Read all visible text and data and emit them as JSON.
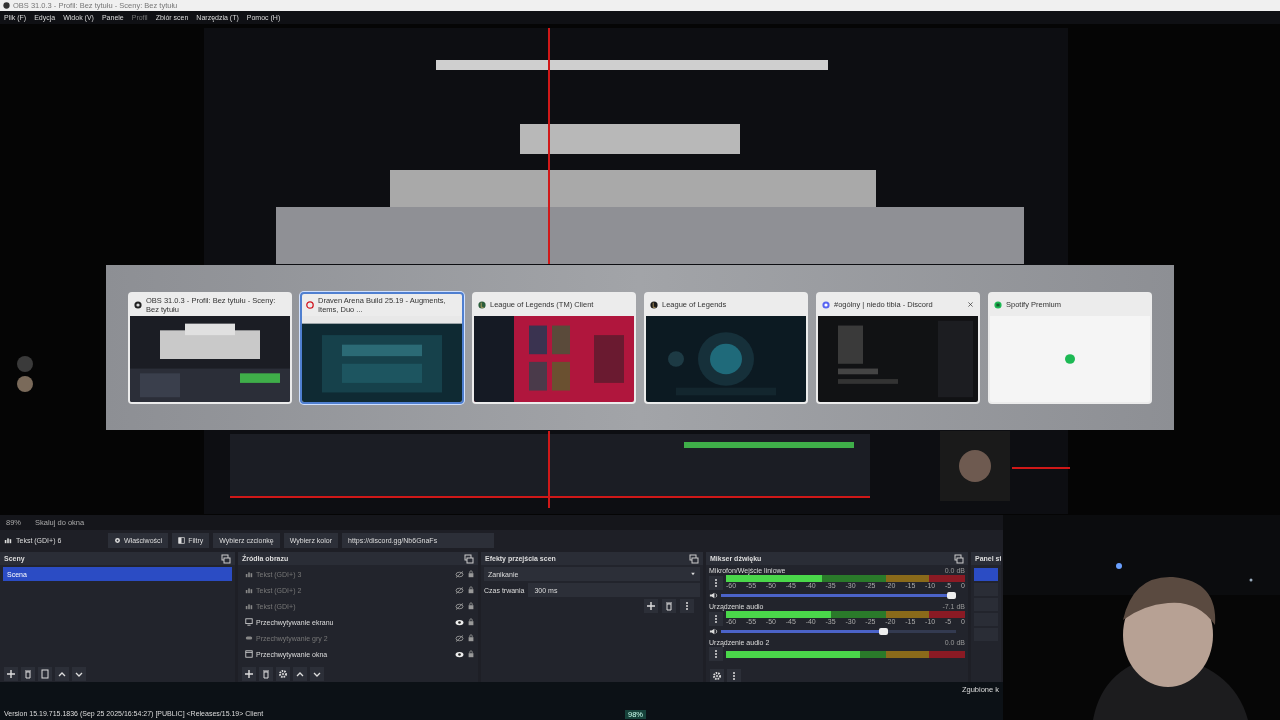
{
  "window": {
    "title": "OBS 31.0.3 - Profil: Bez tytułu - Sceny: Bez tytułu"
  },
  "menu": [
    {
      "label": "Plik (F)",
      "disabled": false
    },
    {
      "label": "Edycja",
      "disabled": false
    },
    {
      "label": "Widok (V)",
      "disabled": false
    },
    {
      "label": "Panele",
      "disabled": false
    },
    {
      "label": "Profil",
      "disabled": true
    },
    {
      "label": "Zbiór scen",
      "disabled": false
    },
    {
      "label": "Narzędzia (T)",
      "disabled": false
    },
    {
      "label": "Pomoc (H)",
      "disabled": false
    }
  ],
  "preview": {
    "kind": "picture",
    "task_switcher": [
      {
        "title": "OBS 31.0.3 - Profil: Bez tytułu - Sceny: Bez tytułu",
        "selected": false,
        "closable": false
      },
      {
        "title": "Draven Arena Build 25.19 - Augments, Items, Duo ...",
        "selected": true,
        "closable": false
      },
      {
        "title": "League of Legends (TM) Client",
        "selected": false,
        "closable": false
      },
      {
        "title": "League of Legends",
        "selected": false,
        "closable": false
      },
      {
        "title": "#ogólny | niedo tibia - Discord",
        "selected": false,
        "closable": true
      },
      {
        "title": "Spotify Premium",
        "selected": false,
        "closable": false
      }
    ]
  },
  "zoom_bar": {
    "zoom": "89%",
    "mode": "Skaluj do okna"
  },
  "source_toolbar": {
    "source": "Tekst (GDI+) 6",
    "buttons": [
      "Właściwości",
      "Filtry",
      "Wybierz czcionkę",
      "Wybierz kolor"
    ],
    "text_value": "https://discord.gg/Nb6GnaFs"
  },
  "scenes": {
    "title": "Sceny",
    "items": [
      {
        "label": "Scena",
        "selected": true
      }
    ]
  },
  "sources": {
    "title": "Źródła obrazu",
    "items": [
      {
        "label": "Tekst (GDI+) 3",
        "kind": "text",
        "visible": false
      },
      {
        "label": "Tekst (GDI+) 2",
        "kind": "text",
        "visible": false
      },
      {
        "label": "Tekst (GDI+)",
        "kind": "text",
        "visible": false
      },
      {
        "label": "Przechwytywanie ekranu",
        "kind": "display",
        "visible": true
      },
      {
        "label": "Przechwytywanie gry 2",
        "kind": "game",
        "visible": false
      },
      {
        "label": "Przechwytywanie okna",
        "kind": "window",
        "visible": true
      }
    ]
  },
  "transitions": {
    "title": "Efekty przejścia scen",
    "effect": "Zanikanie",
    "duration_label": "Czas trwania",
    "duration": "300 ms"
  },
  "mixer": {
    "title": "Mikser dźwięku",
    "channels": [
      {
        "name": "Mikrofon/Wejście liniowe",
        "reading": "0.0 dB",
        "level": 0.4,
        "ticks": [
          "-60",
          "-55",
          "-50",
          "-45",
          "-40",
          "-35",
          "-30",
          "-25",
          "-20",
          "-15",
          "-10",
          "-5",
          "0"
        ],
        "volume": {
          "level": 1.0
        }
      },
      {
        "name": "Urządzenie audio",
        "reading": "-7.1 dB",
        "level": 0.44,
        "ticks": [
          "-60",
          "-55",
          "-50",
          "-45",
          "-40",
          "-35",
          "-30",
          "-25",
          "-20",
          "-15",
          "-10",
          "-5",
          "0"
        ],
        "volume": {
          "level": 0.7
        }
      },
      {
        "name": "Urządzenie audio 2",
        "reading": "0.0 dB",
        "level": 0.56
      }
    ]
  },
  "stats_panel": {
    "title": "Panel st"
  },
  "background": {
    "version": "Version 15.19.715.1836 (Sep 25 2025/16:54:27) [PUBLIC] <Releases/15.19> Client",
    "progress": "98%",
    "label": "Zgubione k"
  }
}
